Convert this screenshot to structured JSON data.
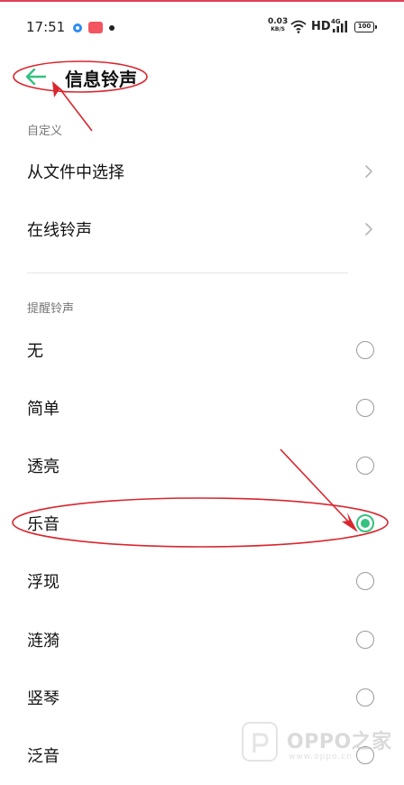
{
  "status_bar": {
    "time": "17:51",
    "net_speed_value": "0.03",
    "net_speed_unit": "KB/S",
    "hd": "HD",
    "signal_label": "4G",
    "battery": "100"
  },
  "header": {
    "title": "信息铃声"
  },
  "custom_section": {
    "label": "自定义",
    "items": [
      {
        "label": "从文件中选择"
      },
      {
        "label": "在线铃声"
      }
    ]
  },
  "ringtone_section": {
    "label": "提醒铃声",
    "items": [
      {
        "label": "无",
        "selected": false
      },
      {
        "label": "简单",
        "selected": false
      },
      {
        "label": "透亮",
        "selected": false
      },
      {
        "label": "乐音",
        "selected": true
      },
      {
        "label": "浮现",
        "selected": false
      },
      {
        "label": "涟漪",
        "selected": false
      },
      {
        "label": "竖琴",
        "selected": false
      },
      {
        "label": "泛音",
        "selected": false
      }
    ]
  },
  "watermark": {
    "brand": "OPPO之家",
    "url": "www.oppo.cn"
  },
  "colors": {
    "accent": "#33c27f",
    "annotation": "#d9262e",
    "status_dot": "#2a8cf0"
  }
}
